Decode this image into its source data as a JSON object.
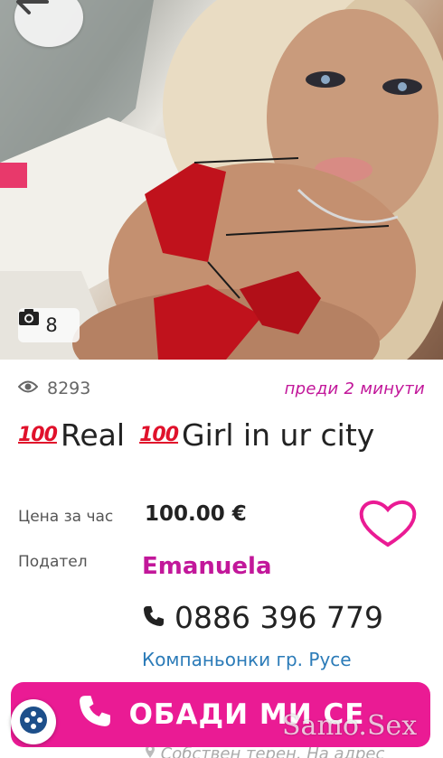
{
  "listing": {
    "photo_count": "8",
    "views": "8293",
    "time_ago": "преди 2 минути",
    "title_part1": "Real",
    "title_part2": "Girl in ur city",
    "hundred_emoji": "100",
    "price_label": "Цена за час",
    "price": "100.00 €",
    "advertiser_label": "Подател",
    "advertiser_name": "Emanuela",
    "phone": "0886 396 779",
    "category": "Компаньонки гр. Русе",
    "address": "Собствен терен, На адрес"
  },
  "actions": {
    "call_label": "ОБАДИ МИ СЕ"
  },
  "watermark": "Samo.Sex",
  "icons": {
    "back": "arrow-left-icon",
    "camera": "camera-icon",
    "eye": "eye-icon",
    "heart": "heart-outline-icon",
    "phone": "phone-icon",
    "location": "location-pin-icon",
    "chat": "chat-icon"
  },
  "colors": {
    "accent": "#ea1b94",
    "name": "#c2179a",
    "link": "#2b7bb8",
    "emoji_red": "#e0112b"
  }
}
